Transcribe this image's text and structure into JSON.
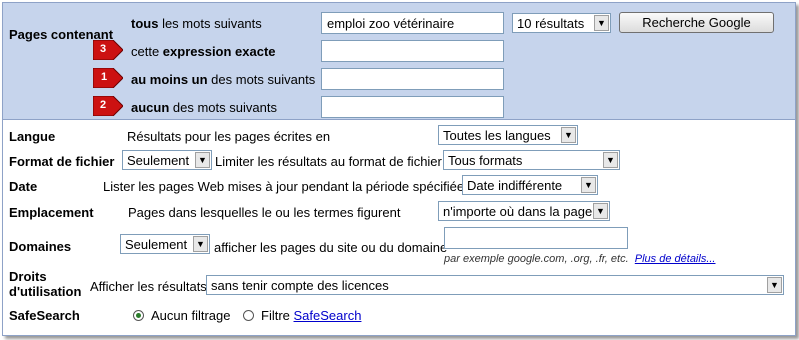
{
  "pages": {
    "label": "Pages contenant",
    "rows": [
      {
        "bold": "tous",
        "rest": " les mots suivants",
        "value": "emploi zoo vétérinaire"
      },
      {
        "pre": "cette ",
        "bold": "expression exacte",
        "rest": "",
        "badge": "3",
        "value": ""
      },
      {
        "bold": "au moins un",
        "rest": " des mots suivants",
        "badge": "1",
        "value": ""
      },
      {
        "bold": "aucun",
        "rest": " des mots suivants",
        "badge": "2",
        "value": ""
      }
    ],
    "results_select": "10 résultats",
    "search_button": "Recherche Google"
  },
  "langue": {
    "label": "Langue",
    "desc": "Résultats pour les pages écrites en",
    "value": "Toutes les langues"
  },
  "format": {
    "label": "Format de fichier",
    "mode": "Seulement",
    "desc": "Limiter les résultats au format de fichier",
    "value": "Tous formats"
  },
  "date": {
    "label": "Date",
    "desc": "Lister les pages Web mises à jour pendant la période spécifiée",
    "value": "Date indifférente"
  },
  "emplacement": {
    "label": "Emplacement",
    "desc": "Pages dans lesquelles le ou les termes figurent",
    "value": "n'importe où dans la page"
  },
  "domaines": {
    "label": "Domaines",
    "mode": "Seulement",
    "desc": "afficher les pages du site ou du domaine",
    "value": "",
    "hint": "par exemple google.com, .org, .fr, etc.",
    "link": "Plus de détails..."
  },
  "droits": {
    "label_line1": "Droits",
    "label_line2": "d'utilisation",
    "desc": "Afficher les résultats",
    "value": "sans tenir compte des licences"
  },
  "safesearch": {
    "label": "SafeSearch",
    "option1": "Aucun filtrage",
    "option2_prefix": "Filtre",
    "option2_link": "SafeSearch",
    "selected": "option1"
  },
  "colors": {
    "header_bg": "#c6d4ec",
    "badge_red": "#cc1111",
    "link": "#0000cc"
  }
}
